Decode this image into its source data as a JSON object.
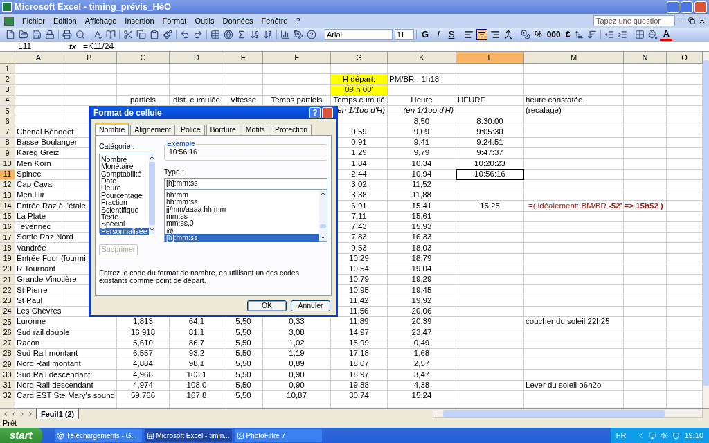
{
  "window": {
    "title": "Microsoft Excel - timing_prévis_HèO"
  },
  "menu": [
    "Fichier",
    "Edition",
    "Affichage",
    "Insertion",
    "Format",
    "Outils",
    "Données",
    "Fenêtre",
    "?"
  ],
  "help_field": {
    "placeholder": "Tapez une question"
  },
  "toolbar": {
    "font": "Arial",
    "size": "11",
    "style_buttons": [
      "G",
      "I",
      "S"
    ],
    "alignment": [
      {
        "selected": false
      },
      {
        "selected": true
      },
      {
        "selected": false
      },
      {
        "selected": false
      }
    ],
    "number_buttons": [
      "%",
      "000",
      "€"
    ],
    "font_color": "A"
  },
  "formula_bar": {
    "name_box": "L11",
    "function_label": "fx",
    "formula": "=K11/24"
  },
  "sheet": {
    "columns": [
      {
        "label": "A",
        "selected": false
      },
      {
        "label": "B",
        "selected": false
      },
      {
        "label": "C",
        "selected": false
      },
      {
        "label": "D",
        "selected": false
      },
      {
        "label": "E",
        "selected": false
      },
      {
        "label": "F",
        "selected": false
      },
      {
        "label": "G",
        "selected": false
      },
      {
        "label": "K",
        "selected": false
      },
      {
        "label": "L",
        "selected": true
      },
      {
        "label": "M",
        "selected": false
      },
      {
        "label": "N",
        "selected": false
      },
      {
        "label": "O",
        "selected": false
      }
    ],
    "rows": [
      {
        "number": "1",
        "selected": false,
        "cells": {}
      },
      {
        "number": "2",
        "selected": false,
        "cells": {
          "G": {
            "text": "H départ:",
            "kind": "highlight"
          },
          "K": {
            "text": "PM/BR - 1h18'",
            "kind": "label"
          }
        }
      },
      {
        "number": "3",
        "selected": false,
        "cells": {
          "G": {
            "text": "09 h 00'",
            "kind": "highlight"
          }
        }
      },
      {
        "number": "4",
        "selected": false,
        "cells": {
          "C": {
            "text": "partiels",
            "kind": "value"
          },
          "D": {
            "text": "dist. cumulée",
            "kind": "value"
          },
          "E": {
            "text": "Vitesse",
            "kind": "value"
          },
          "F": {
            "text": "Temps partiels",
            "kind": "value"
          },
          "G": {
            "text": "Temps cumulé",
            "kind": "value"
          },
          "K": {
            "text": "Heure",
            "kind": "value"
          },
          "L": {
            "text": "HEURE",
            "kind": "label"
          },
          "M": {
            "text": "heure constatée",
            "kind": "label"
          }
        }
      },
      {
        "number": "5",
        "selected": false,
        "cells": {
          "G": {
            "text": "en 1/1oo d'H)",
            "kind": "unit"
          },
          "K": {
            "text": "(en 1/1oo d'H)",
            "kind": "unit"
          },
          "M": {
            "text": "(recalage)",
            "kind": "label"
          }
        }
      },
      {
        "number": "6",
        "selected": false,
        "cells": {
          "K": {
            "text": "8,50",
            "kind": "value"
          },
          "L": {
            "text": "8:30:00",
            "kind": "value"
          }
        }
      },
      {
        "number": "7",
        "selected": false,
        "cells": {
          "A": {
            "text": "Chenal Bénodet",
            "kind": "label"
          },
          "G": {
            "text": "0,59",
            "kind": "value"
          },
          "K": {
            "text": "9,09",
            "kind": "value"
          },
          "L": {
            "text": "9:05:30",
            "kind": "value"
          }
        }
      },
      {
        "number": "8",
        "selected": false,
        "cells": {
          "A": {
            "text": "Basse Boulanger",
            "kind": "label"
          },
          "G": {
            "text": "0,91",
            "kind": "value"
          },
          "K": {
            "text": "9,41",
            "kind": "value"
          },
          "L": {
            "text": "9:24:51",
            "kind": "value"
          }
        }
      },
      {
        "number": "9",
        "selected": false,
        "cells": {
          "A": {
            "text": "Kareg Greiz",
            "kind": "label"
          },
          "G": {
            "text": "1,29",
            "kind": "value"
          },
          "K": {
            "text": "9,79",
            "kind": "value"
          },
          "L": {
            "text": "9:47:37",
            "kind": "value"
          }
        }
      },
      {
        "number": "10",
        "selected": false,
        "cells": {
          "A": {
            "text": "Men Korn",
            "kind": "label"
          },
          "G": {
            "text": "1,84",
            "kind": "value"
          },
          "K": {
            "text": "10,34",
            "kind": "value"
          },
          "L": {
            "text": "10:20:23",
            "kind": "value"
          }
        }
      },
      {
        "number": "11",
        "selected": true,
        "cells": {
          "A": {
            "text": "Spinec",
            "kind": "label"
          },
          "G": {
            "text": "2,44",
            "kind": "value"
          },
          "K": {
            "text": "10,94",
            "kind": "value"
          },
          "L": {
            "text": "10:56:16",
            "kind": "value"
          }
        }
      },
      {
        "number": "12",
        "selected": false,
        "cells": {
          "A": {
            "text": "Cap Caval",
            "kind": "label"
          },
          "G": {
            "text": "3,02",
            "kind": "value"
          },
          "K": {
            "text": "11,52",
            "kind": "value"
          }
        }
      },
      {
        "number": "13",
        "selected": false,
        "cells": {
          "A": {
            "text": "Men Hir",
            "kind": "label"
          },
          "G": {
            "text": "3,38",
            "kind": "value"
          },
          "K": {
            "text": "11,88",
            "kind": "value"
          }
        }
      },
      {
        "number": "14",
        "selected": false,
        "cells": {
          "A": {
            "text": "Entrée Raz à l'étale",
            "kind": "label"
          },
          "G": {
            "text": "6,91",
            "kind": "value"
          },
          "K": {
            "text": "15,41",
            "kind": "value"
          },
          "L": {
            "text": "15,25",
            "kind": "value"
          },
          "M": {
            "text": "=( idéalement: BM/BR  **-52' => 15h52 )**",
            "kind": "note"
          }
        }
      },
      {
        "number": "15",
        "selected": false,
        "cells": {
          "A": {
            "text": "La Plate",
            "kind": "label"
          },
          "G": {
            "text": "7,11",
            "kind": "value"
          },
          "K": {
            "text": "15,61",
            "kind": "value"
          }
        }
      },
      {
        "number": "16",
        "selected": false,
        "cells": {
          "A": {
            "text": "Tevennec",
            "kind": "label"
          },
          "G": {
            "text": "7,43",
            "kind": "value"
          },
          "K": {
            "text": "15,93",
            "kind": "value"
          }
        }
      },
      {
        "number": "17",
        "selected": false,
        "cells": {
          "A": {
            "text": "Sortie Raz Nord",
            "kind": "label"
          },
          "G": {
            "text": "7,83",
            "kind": "value"
          },
          "K": {
            "text": "16,33",
            "kind": "value"
          }
        }
      },
      {
        "number": "18",
        "selected": false,
        "cells": {
          "A": {
            "text": "Vandrée",
            "kind": "label"
          },
          "G": {
            "text": "9,53",
            "kind": "value"
          },
          "K": {
            "text": "18,03",
            "kind": "value"
          }
        }
      },
      {
        "number": "19",
        "selected": false,
        "cells": {
          "A": {
            "text": "Entrée Four (fourmi",
            "kind": "label"
          },
          "G": {
            "text": "10,29",
            "kind": "value"
          },
          "K": {
            "text": "18,79",
            "kind": "value"
          }
        }
      },
      {
        "number": "20",
        "selected": false,
        "cells": {
          "A": {
            "text": "R Tournant",
            "kind": "label"
          },
          "G": {
            "text": "10,54",
            "kind": "value"
          },
          "K": {
            "text": "19,04",
            "kind": "value"
          }
        }
      },
      {
        "number": "21",
        "selected": false,
        "cells": {
          "A": {
            "text": "Grande Vinotière",
            "kind": "label"
          },
          "G": {
            "text": "10,79",
            "kind": "value"
          },
          "K": {
            "text": "19,29",
            "kind": "value"
          }
        }
      },
      {
        "number": "22",
        "selected": false,
        "cells": {
          "A": {
            "text": "St Pierre",
            "kind": "label"
          },
          "G": {
            "text": "10,95",
            "kind": "value"
          },
          "K": {
            "text": "19,45",
            "kind": "value"
          }
        }
      },
      {
        "number": "23",
        "selected": false,
        "cells": {
          "A": {
            "text": "St Paul",
            "kind": "label"
          },
          "G": {
            "text": "11,42",
            "kind": "value"
          },
          "K": {
            "text": "19,92",
            "kind": "value"
          }
        }
      },
      {
        "number": "24",
        "selected": false,
        "cells": {
          "A": {
            "text": "Les Chèvres",
            "kind": "label"
          },
          "G": {
            "text": "11,56",
            "kind": "value"
          },
          "K": {
            "text": "20,06",
            "kind": "value"
          }
        }
      },
      {
        "number": "25",
        "selected": false,
        "cells": {
          "A": {
            "text": "Luronne",
            "kind": "label"
          },
          "C": {
            "text": "1,813",
            "kind": "value"
          },
          "D": {
            "text": "64,1",
            "kind": "value"
          },
          "E": {
            "text": "5,50",
            "kind": "value"
          },
          "F": {
            "text": "0,33",
            "kind": "value"
          },
          "G": {
            "text": "11,89",
            "kind": "value"
          },
          "K": {
            "text": "20,39",
            "kind": "value"
          },
          "M": {
            "text": "coucher du soleil 22h25",
            "kind": "label"
          }
        }
      },
      {
        "number": "26",
        "selected": false,
        "cells": {
          "A": {
            "text": "Sud rail double",
            "kind": "label"
          },
          "C": {
            "text": "16,918",
            "kind": "value"
          },
          "D": {
            "text": "81,1",
            "kind": "value"
          },
          "E": {
            "text": "5,50",
            "kind": "value"
          },
          "F": {
            "text": "3,08",
            "kind": "value"
          },
          "G": {
            "text": "14,97",
            "kind": "value"
          },
          "K": {
            "text": "23,47",
            "kind": "value"
          }
        }
      },
      {
        "number": "27",
        "selected": false,
        "cells": {
          "A": {
            "text": "Racon",
            "kind": "label"
          },
          "C": {
            "text": "5,610",
            "kind": "value"
          },
          "D": {
            "text": "86,7",
            "kind": "value"
          },
          "E": {
            "text": "5,50",
            "kind": "value"
          },
          "F": {
            "text": "1,02",
            "kind": "value"
          },
          "G": {
            "text": "15,99",
            "kind": "value"
          },
          "K": {
            "text": "0,49",
            "kind": "value"
          }
        }
      },
      {
        "number": "28",
        "selected": false,
        "cells": {
          "A": {
            "text": "Sud Rail montant",
            "kind": "label"
          },
          "C": {
            "text": "6,557",
            "kind": "value"
          },
          "D": {
            "text": "93,2",
            "kind": "value"
          },
          "E": {
            "text": "5,50",
            "kind": "value"
          },
          "F": {
            "text": "1,19",
            "kind": "value"
          },
          "G": {
            "text": "17,18",
            "kind": "value"
          },
          "K": {
            "text": "1,68",
            "kind": "value"
          }
        }
      },
      {
        "number": "29",
        "selected": false,
        "cells": {
          "A": {
            "text": "Nord Rail montant",
            "kind": "label"
          },
          "C": {
            "text": "4,884",
            "kind": "value"
          },
          "D": {
            "text": "98,1",
            "kind": "value"
          },
          "E": {
            "text": "5,50",
            "kind": "value"
          },
          "F": {
            "text": "0,89",
            "kind": "value"
          },
          "G": {
            "text": "18,07",
            "kind": "value"
          },
          "K": {
            "text": "2,57",
            "kind": "value"
          }
        }
      },
      {
        "number": "30",
        "selected": false,
        "cells": {
          "A": {
            "text": "Sud Rail descendant",
            "kind": "label"
          },
          "C": {
            "text": "4,968",
            "kind": "value"
          },
          "D": {
            "text": "103,1",
            "kind": "value"
          },
          "E": {
            "text": "5,50",
            "kind": "value"
          },
          "F": {
            "text": "0,90",
            "kind": "value"
          },
          "G": {
            "text": "18,97",
            "kind": "value"
          },
          "K": {
            "text": "3,47",
            "kind": "value"
          }
        }
      },
      {
        "number": "31",
        "selected": false,
        "cells": {
          "A": {
            "text": "Nord Rail descendant",
            "kind": "label"
          },
          "C": {
            "text": "4,974",
            "kind": "value"
          },
          "D": {
            "text": "108,0",
            "kind": "value"
          },
          "E": {
            "text": "5,50",
            "kind": "value"
          },
          "F": {
            "text": "0,90",
            "kind": "value"
          },
          "G": {
            "text": "19,88",
            "kind": "value"
          },
          "K": {
            "text": "4,38",
            "kind": "value"
          },
          "M": {
            "text": "Lever du soleil o6h2o",
            "kind": "label"
          }
        }
      },
      {
        "number": "32",
        "selected": false,
        "cells": {
          "A": {
            "text": "Card EST Ste Mary's sound",
            "kind": "label"
          },
          "C": {
            "text": "59,766",
            "kind": "value"
          },
          "D": {
            "text": "167,8",
            "kind": "value"
          },
          "E": {
            "text": "5,50",
            "kind": "value"
          },
          "F": {
            "text": "10,87",
            "kind": "value"
          },
          "G": {
            "text": "30,74",
            "kind": "value"
          },
          "K": {
            "text": "15,24",
            "kind": "value"
          }
        }
      }
    ],
    "sheet_tabs": [
      {
        "label": "Feuil1 (2)",
        "selected": true
      }
    ]
  },
  "status_bar": "Prêt",
  "dialog": {
    "title": "Format de cellule",
    "help": "?",
    "tabs": [
      {
        "label": "Nombre",
        "selected": true
      },
      {
        "label": "Alignement",
        "selected": false
      },
      {
        "label": "Police",
        "selected": false
      },
      {
        "label": "Bordure",
        "selected": false
      },
      {
        "label": "Motifs",
        "selected": false
      },
      {
        "label": "Protection",
        "selected": false
      }
    ],
    "category_label": "Catégorie :",
    "categories": [
      {
        "label": "Nombre",
        "selected": false
      },
      {
        "label": "Monétaire",
        "selected": false
      },
      {
        "label": "Comptabilité",
        "selected": false
      },
      {
        "label": "Date",
        "selected": false
      },
      {
        "label": "Heure",
        "selected": false
      },
      {
        "label": "Pourcentage",
        "selected": false
      },
      {
        "label": "Fraction",
        "selected": false
      },
      {
        "label": "Scientifique",
        "selected": false
      },
      {
        "label": "Texte",
        "selected": false
      },
      {
        "label": "Spécial",
        "selected": false
      },
      {
        "label": "Personnalisée",
        "selected": true
      }
    ],
    "example_label": "Exemple",
    "example_value": "10:56:16",
    "type_label": "Type :",
    "type_value": "[h]:mm:ss",
    "types": [
      {
        "label": "hh:mm",
        "selected": false
      },
      {
        "label": "hh:mm:ss",
        "selected": false
      },
      {
        "label": "jj/mm/aaaa hh:mm",
        "selected": false
      },
      {
        "label": "mm:ss",
        "selected": false
      },
      {
        "label": "mm:ss,0",
        "selected": false
      },
      {
        "label": "@",
        "selected": false
      },
      {
        "label": "[h]:mm:ss",
        "selected": true
      }
    ],
    "delete_button": {
      "label": "Supprimer",
      "disabled": true
    },
    "description": "Entrez le code du format de nombre, en utilisant un des codes existants comme point de départ.",
    "buttons": [
      "OK",
      "Annuler"
    ]
  },
  "taskbar": {
    "start": "start",
    "buttons": [
      {
        "label": "Téléchargements - G...",
        "selected": false
      },
      {
        "label": "Microsoft Excel - timin...",
        "selected": true
      },
      {
        "label": "PhotoFiltre 7",
        "selected": false
      }
    ],
    "language": "FR",
    "clock": "19:10"
  }
}
